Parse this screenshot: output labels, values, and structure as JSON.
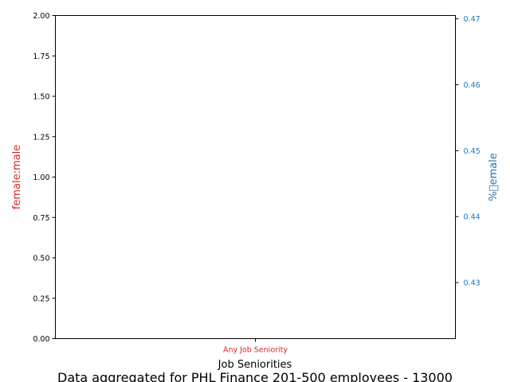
{
  "colors": {
    "left_axis": "#d62728",
    "right_axis": "#1f77b4",
    "frame": "#000000",
    "background": "#ffffff"
  },
  "chart_data": {
    "type": "bar",
    "title": "",
    "xlabel": "Job Seniorities",
    "ylabel_left": "female:male",
    "ylabel_right": "%\u0000emale",
    "categories": [
      "Any Job Seniority"
    ],
    "series": [],
    "ylim_left": [
      0,
      2.0
    ],
    "ylim_right": [
      0.4215,
      0.4705
    ],
    "yticks_left": [
      "0.00",
      "0.25",
      "0.50",
      "0.75",
      "1.00",
      "1.25",
      "1.50",
      "1.75",
      "2.00"
    ],
    "yticks_right": [
      "0.43",
      "0.44",
      "0.45",
      "0.46",
      "0.47"
    ],
    "grid": false,
    "footer": "Data aggregated for PHL Finance 201-500 employees - 13000"
  }
}
